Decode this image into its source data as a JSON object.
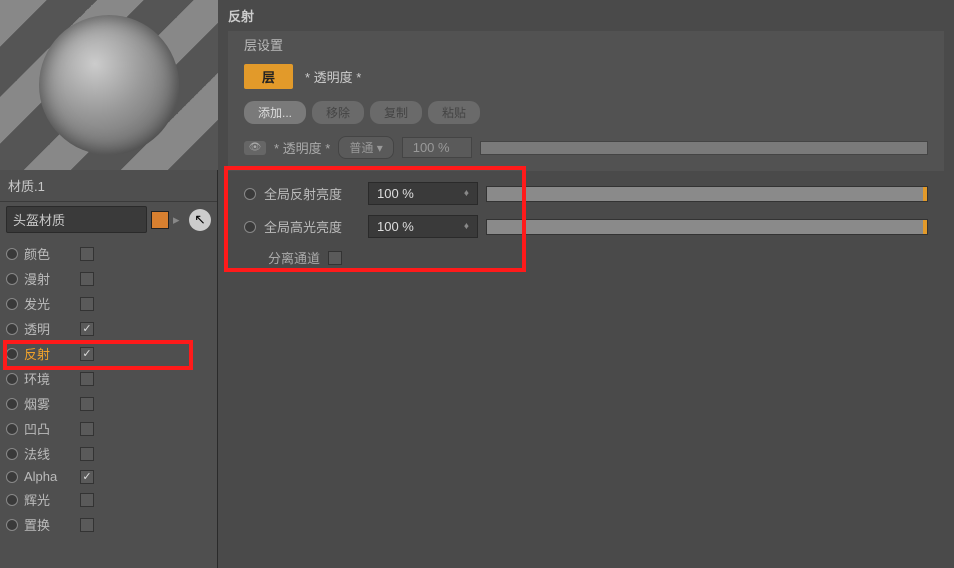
{
  "material": {
    "name": "材质.1",
    "type": "头盔材质"
  },
  "channels": [
    {
      "label": "颜色",
      "checked": false
    },
    {
      "label": "漫射",
      "checked": false
    },
    {
      "label": "发光",
      "checked": false
    },
    {
      "label": "透明",
      "checked": true
    },
    {
      "label": "反射",
      "checked": true,
      "highlighted": true
    },
    {
      "label": "环境",
      "checked": false
    },
    {
      "label": "烟雾",
      "checked": false
    },
    {
      "label": "凹凸",
      "checked": false
    },
    {
      "label": "法线",
      "checked": false
    },
    {
      "label": "Alpha",
      "checked": true
    },
    {
      "label": "辉光",
      "checked": false
    },
    {
      "label": "置换",
      "checked": false
    }
  ],
  "panel": {
    "title": "反射",
    "section": "层设置",
    "tab_active": "层",
    "tab_other": "* 透明度 *",
    "buttons": {
      "add": "添加...",
      "remove": "移除",
      "copy": "复制",
      "paste": "粘贴"
    },
    "opacity": {
      "label": "* 透明度 *",
      "blend": "普通",
      "value": "100 %"
    },
    "globals": {
      "reflect_label": "全局反射亮度",
      "reflect_value": "100 %",
      "spec_label": "全局高光亮度",
      "spec_value": "100 %",
      "separate_label": "分离通道"
    }
  }
}
